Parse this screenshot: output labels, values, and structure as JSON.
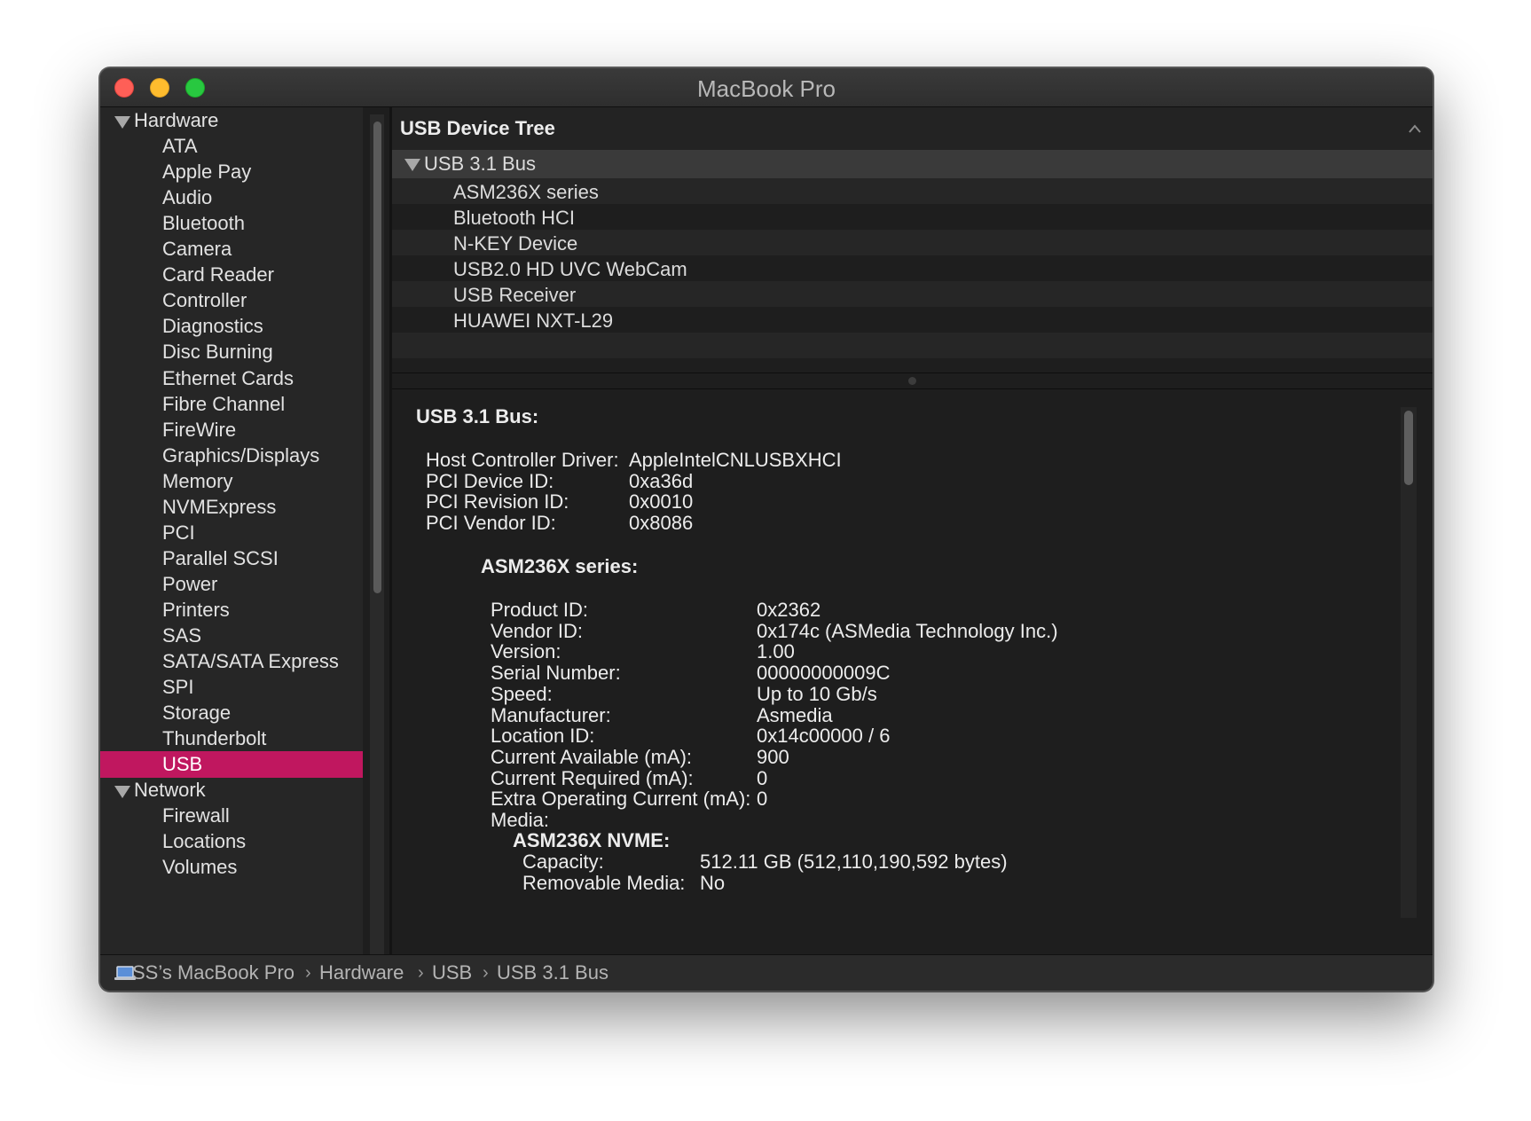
{
  "window": {
    "title": "MacBook Pro"
  },
  "sidebar": {
    "groups": [
      {
        "label": "Hardware",
        "items": [
          "ATA",
          "Apple Pay",
          "Audio",
          "Bluetooth",
          "Camera",
          "Card Reader",
          "Controller",
          "Diagnostics",
          "Disc Burning",
          "Ethernet Cards",
          "Fibre Channel",
          "FireWire",
          "Graphics/Displays",
          "Memory",
          "NVMExpress",
          "PCI",
          "Parallel SCSI",
          "Power",
          "Printers",
          "SAS",
          "SATA/SATA Express",
          "SPI",
          "Storage",
          "Thunderbolt",
          "USB"
        ]
      },
      {
        "label": "Network",
        "items": [
          "Firewall",
          "Locations",
          "Volumes"
        ]
      }
    ],
    "selected": "USB",
    "selected_color": "#c0175f"
  },
  "tree": {
    "header": "USB Device Tree",
    "bus": "USB 3.1 Bus",
    "devices": [
      "ASM236X series",
      "Bluetooth HCI",
      "N-KEY Device",
      "USB2.0 HD UVC WebCam",
      "USB Receiver",
      "HUAWEI NXT-L29"
    ]
  },
  "detail": {
    "bus_title": "USB 3.1 Bus:",
    "bus_props": [
      {
        "k": "Host Controller Driver:",
        "v": "AppleIntelCNLUSBXHCI"
      },
      {
        "k": "PCI Device ID:",
        "v": "0xa36d"
      },
      {
        "k": "PCI Revision ID:",
        "v": "0x0010"
      },
      {
        "k": "PCI Vendor ID:",
        "v": "0x8086"
      }
    ],
    "device_title": "ASM236X series:",
    "device_props": [
      {
        "k": "Product ID:",
        "v": "0x2362"
      },
      {
        "k": "Vendor ID:",
        "v": "0x174c  (ASMedia Technology Inc.)"
      },
      {
        "k": "Version:",
        "v": "1.00"
      },
      {
        "k": "Serial Number:",
        "v": "00000000009C"
      },
      {
        "k": "Speed:",
        "v": "Up to 10 Gb/s"
      },
      {
        "k": "Manufacturer:",
        "v": "Asmedia"
      },
      {
        "k": "Location ID:",
        "v": "0x14c00000 / 6"
      },
      {
        "k": "Current Available (mA):",
        "v": "900"
      },
      {
        "k": "Current Required (mA):",
        "v": "0"
      },
      {
        "k": "Extra Operating Current (mA):",
        "v": "0"
      },
      {
        "k": "Media:",
        "v": ""
      }
    ],
    "media_title": "ASM236X NVME:",
    "media_props": [
      {
        "k": "Capacity:",
        "v": "512.11 GB (512,110,190,592 bytes)"
      },
      {
        "k": "Removable Media:",
        "v": "No"
      }
    ]
  },
  "breadcrumb": [
    "SS’s MacBook Pro",
    "Hardware",
    "USB",
    "USB 3.1 Bus"
  ],
  "icons": [
    "macbook-icon",
    "disclosure-triangle-icon",
    "collapse-chevron-icon",
    "chevron-right-icon"
  ]
}
